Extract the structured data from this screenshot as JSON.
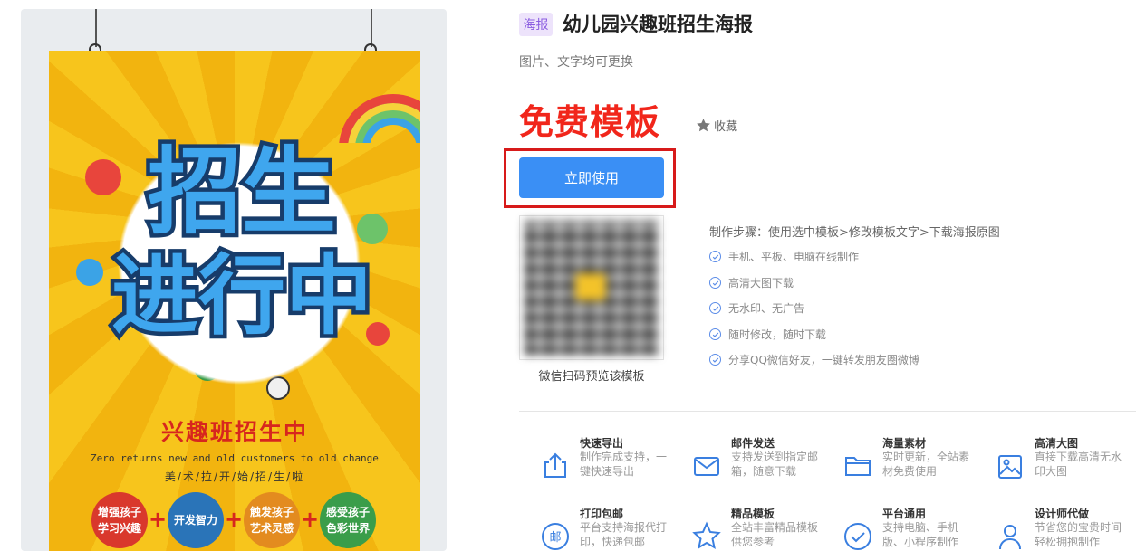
{
  "poster": {
    "headline_line1": "招生",
    "headline_line2": "进行中",
    "sub_title": "兴趣班招生中",
    "english_line": "Zero returns new and old customers to old change",
    "slogan": "美/术/拉/开/始/招/生/啦",
    "circles": [
      {
        "line1": "增强孩子",
        "line2": "学习兴趣",
        "color": "#d9382c"
      },
      {
        "line1": "开发智力",
        "line2": "",
        "color": "#2a74b8"
      },
      {
        "line1": "触发孩子",
        "line2": "艺术灵感",
        "color": "#e38b1f"
      },
      {
        "line1": "感受孩子",
        "line2": "色彩世界",
        "color": "#3a9d4a"
      }
    ]
  },
  "template": {
    "tag": "海报",
    "title": "幼儿园兴趣班招生海报",
    "subtitle": "图片、文字均可更换",
    "price_label": "免费模板",
    "favorite_label": "收藏",
    "use_button": "立即使用",
    "qr_caption": "微信扫码预览该模板"
  },
  "steps": {
    "title": "制作步骤：使用选中模板>修改模板文字>下载海报原图",
    "features": [
      "手机、平板、电脑在线制作",
      "高清大图下载",
      "无水印、无广告",
      "随时修改，随时下载",
      "分享QQ微信好友，一键转发朋友圈微博"
    ]
  },
  "services": [
    {
      "title": "快速导出",
      "desc": "制作完成支持，一键快速导出",
      "icon": "export-icon"
    },
    {
      "title": "邮件发送",
      "desc": "支持发送到指定邮箱，随意下载",
      "icon": "mail-icon"
    },
    {
      "title": "海量素材",
      "desc": "实时更新，全站素材免费使用",
      "icon": "folder-icon"
    },
    {
      "title": "高清大图",
      "desc": "直接下载高清无水印大图",
      "icon": "image-icon"
    },
    {
      "title": "打印包邮",
      "desc": "平台支持海报代打印，快递包邮",
      "icon": "post-icon"
    },
    {
      "title": "精品模板",
      "desc": "全站丰富精品模板供您参考",
      "icon": "star-icon"
    },
    {
      "title": "平台通用",
      "desc": "支持电脑、手机版、小程序制作",
      "icon": "check-circle-icon"
    },
    {
      "title": "设计师代做",
      "desc": "节省您的宝贵时间轻松拥抱制作",
      "icon": "designer-icon"
    }
  ],
  "colors": {
    "primary_button": "#3a8ff5",
    "price_red": "#f1261b",
    "highlight_border": "#d71a1a",
    "icon_blue": "#3a7fe0",
    "tag_bg": "#ede3fb"
  }
}
